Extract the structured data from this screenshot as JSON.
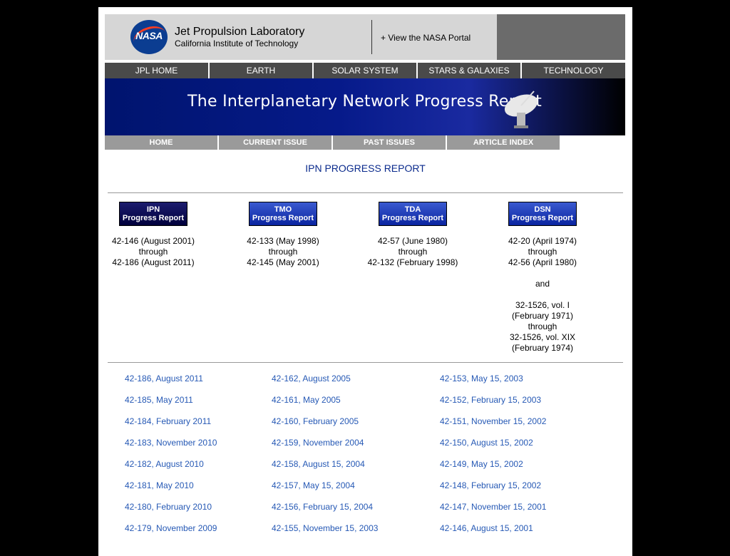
{
  "header": {
    "title": "Jet Propulsion Laboratory",
    "subtitle": "California Institute of Technology",
    "logo_text": "NASA",
    "portal_link": "+ View the NASA Portal"
  },
  "top_nav": [
    "JPL HOME",
    "EARTH",
    "SOLAR SYSTEM",
    "STARS & GALAXIES",
    "TECHNOLOGY"
  ],
  "banner": {
    "title": "The Interplanetary Network Progress Report"
  },
  "sub_nav": [
    "HOME",
    "CURRENT ISSUE",
    "PAST ISSUES",
    "ARTICLE INDEX"
  ],
  "heading": "IPN PROGRESS REPORT",
  "series": [
    {
      "name": "IPN",
      "label": "Progress Report",
      "lines": [
        "42-146 (August 2001)",
        "through",
        "42-186 (August 2011)"
      ]
    },
    {
      "name": "TMO",
      "label": "Progress Report",
      "lines": [
        "42-133 (May 1998)",
        "through",
        "42-145 (May 2001)"
      ]
    },
    {
      "name": "TDA",
      "label": "Progress Report",
      "lines": [
        "42-57 (June 1980)",
        "through",
        "42-132 (February 1998)"
      ]
    },
    {
      "name": "DSN",
      "label": "Progress Report",
      "lines": [
        "42-20 (April 1974)",
        "through",
        "42-56 (April 1980)",
        "",
        "and",
        "",
        "32-1526, vol. I",
        "(February 1971)",
        "through",
        "32-1526, vol. XIX",
        "(February 1974)"
      ]
    }
  ],
  "issues": {
    "col1": [
      "42-186, August 2011",
      "42-185, May 2011",
      "42-184, February 2011",
      "42-183, November 2010",
      "42-182, August 2010",
      "42-181, May 2010",
      "42-180, February 2010",
      "42-179, November 2009"
    ],
    "col2": [
      "42-162, August 2005",
      "42-161, May 2005",
      "42-160, February 2005",
      "42-159, November 2004",
      "42-158, August 15, 2004",
      "42-157, May 15, 2004",
      "42-156, February 15, 2004",
      "42-155, November 15, 2003"
    ],
    "col3": [
      "42-153, May 15, 2003",
      "42-152, February 15, 2003",
      "42-151, November 15, 2002",
      "42-150, August 15, 2002",
      "42-149, May 15, 2002",
      "42-148, February 15, 2002",
      "42-147, November 15, 2001",
      "42-146, August 15, 2001"
    ]
  },
  "colors": {
    "link": "#2659b5",
    "heading": "#0a2a8c",
    "nav": "#4a4a4a",
    "subnav": "#9a9a9a"
  }
}
